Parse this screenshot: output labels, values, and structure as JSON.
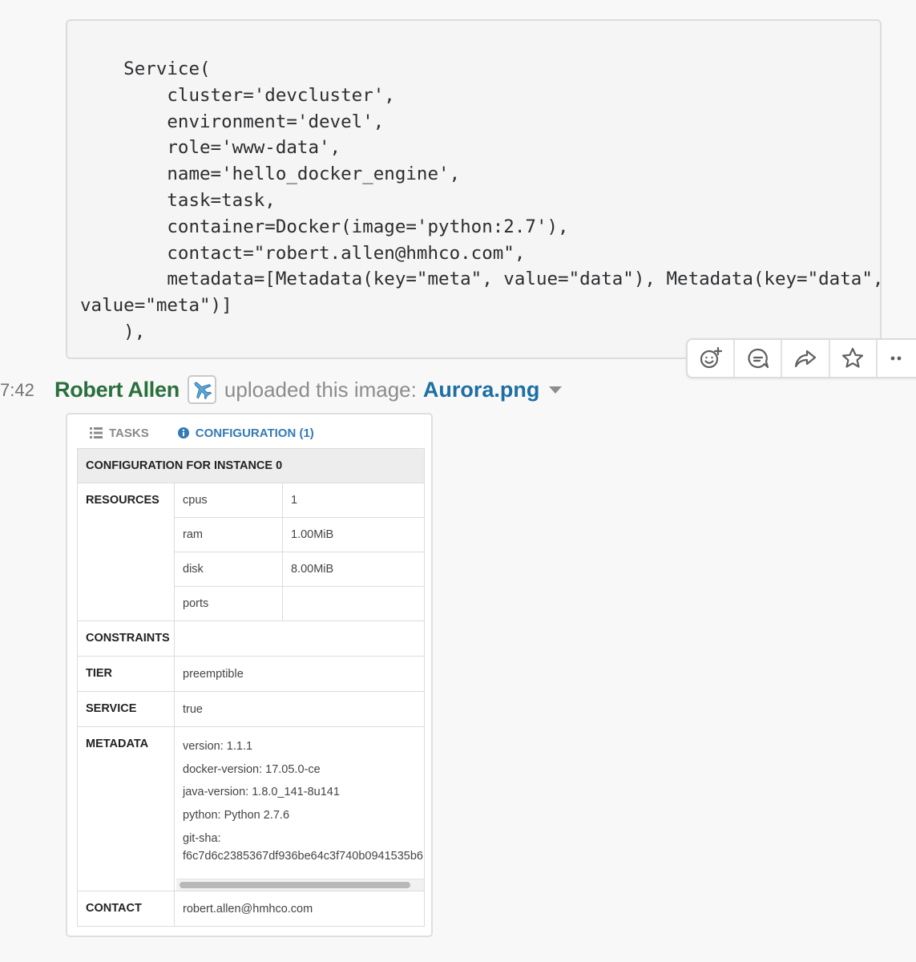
{
  "code": {
    "text": "    Service(\n        cluster='devcluster',\n        environment='devel',\n        role='www-data',\n        name='hello_docker_engine',\n        task=task,\n        container=Docker(image='python:2.7'),\n        contact=\"robert.allen@hmhco.com\",\n        metadata=[Metadata(key=\"meta\", value=\"data\"), Metadata(key=\"data\",\nvalue=\"meta\")]\n    ),"
  },
  "message_actions": [
    "add-reaction-icon",
    "start-thread-icon",
    "share-message-icon",
    "star-icon",
    "more-actions-icon"
  ],
  "message": {
    "timestamp": "7:42",
    "author": "Robert Allen",
    "status_emoji": "airplane",
    "upload_text": "uploaded this image:",
    "filename": "Aurora.png"
  },
  "image": {
    "tabs": {
      "tasks": "TASKS",
      "configuration": "CONFIGURATION (1)"
    },
    "table_title": "CONFIGURATION FOR INSTANCE 0",
    "labels": {
      "resources": "RESOURCES",
      "constraints": "CONSTRAINTS",
      "tier": "TIER",
      "service": "SERVICE",
      "metadata": "METADATA",
      "contact": "CONTACT"
    },
    "resources": [
      {
        "key": "cpus",
        "value": "1"
      },
      {
        "key": "ram",
        "value": "1.00MiB"
      },
      {
        "key": "disk",
        "value": "8.00MiB"
      },
      {
        "key": "ports",
        "value": ""
      }
    ],
    "constraints": "",
    "tier": "preemptible",
    "service": "true",
    "metadata": [
      "version: 1.1.1",
      "docker-version: 17.05.0-ce",
      "java-version: 1.8.0_141-8u141",
      "python: Python 2.7.6"
    ],
    "git_sha_label": "git-sha:",
    "git_sha_value": "f6c7d6c2385367df936be64c3f740b0941535b6",
    "contact": "robert.allen@hmhco.com"
  },
  "colors": {
    "author": "#2a6f3c",
    "filename": "#1d6ea3",
    "active_tab": "#337ab7"
  }
}
